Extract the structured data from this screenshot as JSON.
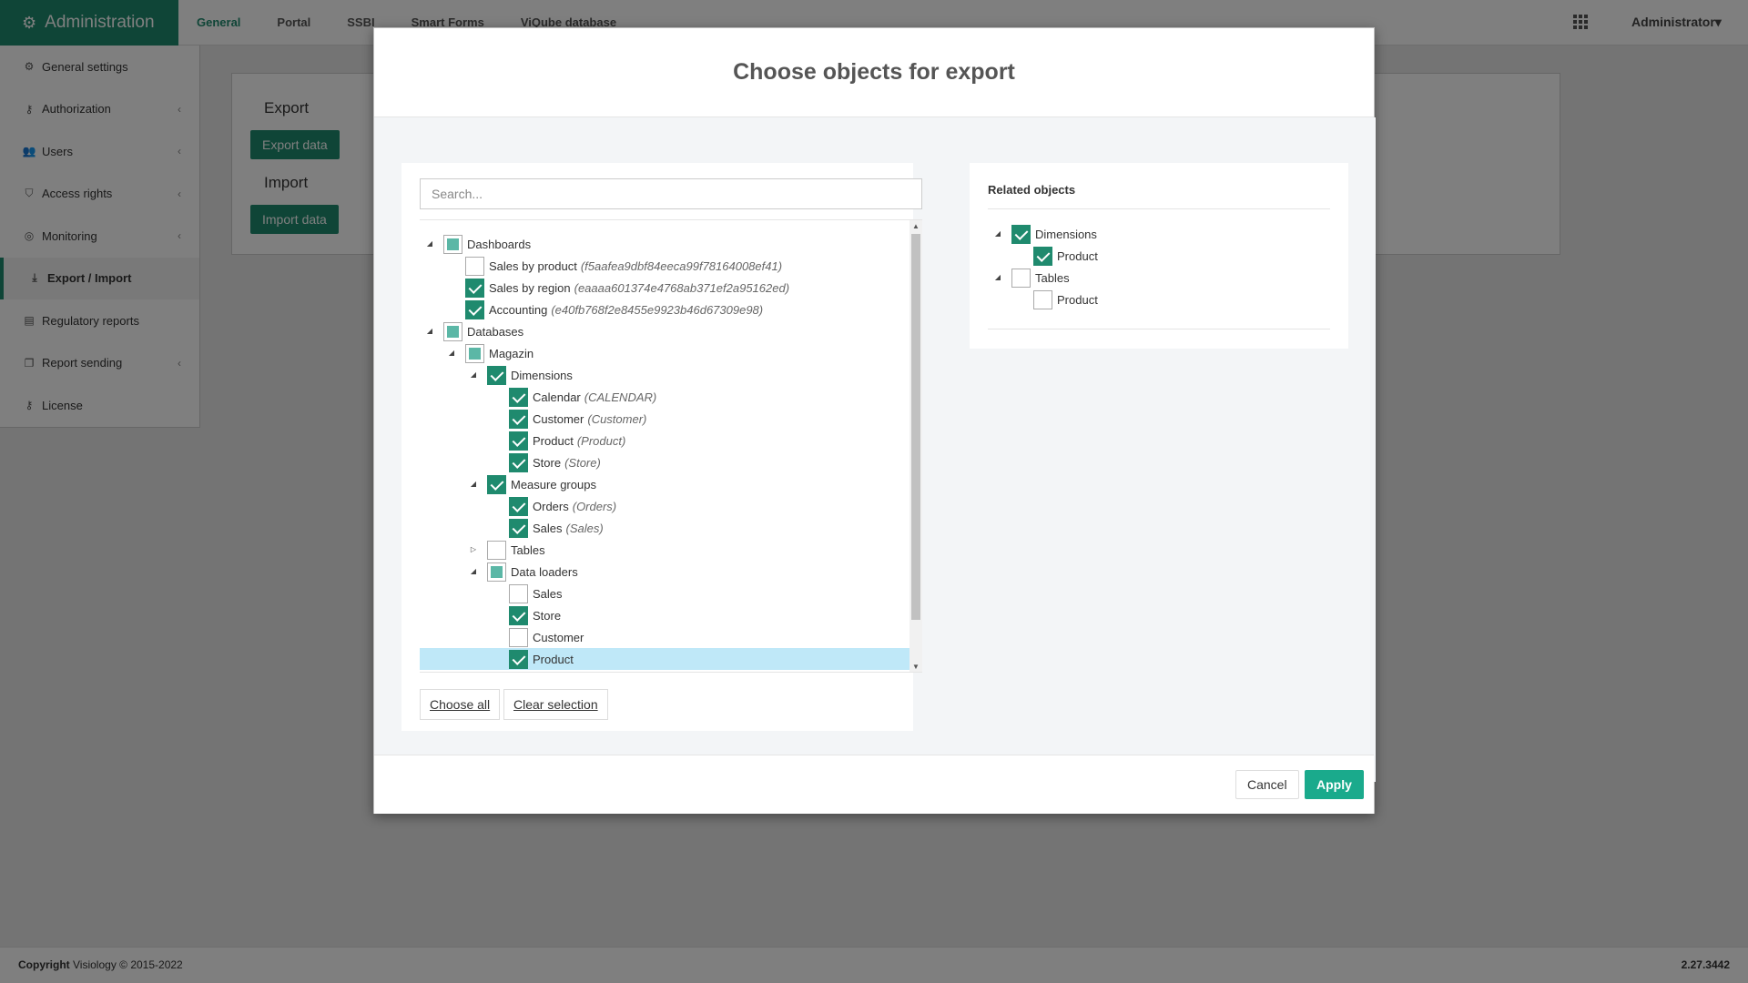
{
  "app": {
    "title": "Administration",
    "icon": "gears-icon"
  },
  "top_nav": [
    "General",
    "Portal",
    "SSBI",
    "Smart Forms",
    "ViQube database"
  ],
  "top_nav_active": "General",
  "user_menu": "Administrator",
  "sidebar": {
    "items": [
      {
        "label": "General settings",
        "icon": "gear-icon",
        "has_submenu": false
      },
      {
        "label": "Authorization",
        "icon": "key-icon",
        "has_submenu": true
      },
      {
        "label": "Users",
        "icon": "users-icon",
        "has_submenu": true
      },
      {
        "label": "Access rights",
        "icon": "shield-icon",
        "has_submenu": true
      },
      {
        "label": "Monitoring",
        "icon": "monitoring-icon",
        "has_submenu": true
      },
      {
        "label": "Export / Import",
        "icon": "download-icon",
        "has_submenu": false,
        "active": true
      },
      {
        "label": "Regulatory reports",
        "icon": "document-icon",
        "has_submenu": false
      },
      {
        "label": "Report sending",
        "icon": "copy-icon",
        "has_submenu": true
      },
      {
        "label": "License",
        "icon": "key-icon",
        "has_submenu": false
      }
    ]
  },
  "background": {
    "export_heading": "Export",
    "export_button": "Export data",
    "import_heading": "Import",
    "import_button": "Import data"
  },
  "footer": {
    "copyright_bold": "Copyright",
    "copyright_text": "Visiology © 2015-2022",
    "version": "2.27.3442"
  },
  "modal": {
    "title": "Choose objects for export",
    "search_placeholder": "Search...",
    "choose_all": "Choose all",
    "clear_selection": "Clear selection",
    "cancel": "Cancel",
    "apply": "Apply",
    "related_title": "Related objects",
    "tree": [
      {
        "depth": 0,
        "toggle": "expanded",
        "state": "partial",
        "label": "Dashboards",
        "code": ""
      },
      {
        "depth": 1,
        "toggle": "none",
        "state": "unchecked",
        "label": "Sales by product",
        "code": "(f5aafea9dbf84eeca99f78164008ef41)"
      },
      {
        "depth": 1,
        "toggle": "none",
        "state": "checked",
        "label": "Sales by region",
        "code": "(eaaaa601374e4768ab371ef2a95162ed)"
      },
      {
        "depth": 1,
        "toggle": "none",
        "state": "checked",
        "label": "Accounting",
        "code": "(e40fb768f2e8455e9923b46d67309e98)"
      },
      {
        "depth": 0,
        "toggle": "expanded",
        "state": "partial",
        "label": "Databases",
        "code": ""
      },
      {
        "depth": 1,
        "toggle": "expanded",
        "state": "partial",
        "label": "Magazin",
        "code": ""
      },
      {
        "depth": 2,
        "toggle": "expanded",
        "state": "checked",
        "label": "Dimensions",
        "code": ""
      },
      {
        "depth": 3,
        "toggle": "none",
        "state": "checked",
        "label": "Calendar",
        "code": "(CALENDAR)"
      },
      {
        "depth": 3,
        "toggle": "none",
        "state": "checked",
        "label": "Customer",
        "code": "(Customer)"
      },
      {
        "depth": 3,
        "toggle": "none",
        "state": "checked",
        "label": "Product",
        "code": "(Product)"
      },
      {
        "depth": 3,
        "toggle": "none",
        "state": "checked",
        "label": "Store",
        "code": "(Store)"
      },
      {
        "depth": 2,
        "toggle": "expanded",
        "state": "checked",
        "label": "Measure groups",
        "code": ""
      },
      {
        "depth": 3,
        "toggle": "none",
        "state": "checked",
        "label": "Orders",
        "code": "(Orders)"
      },
      {
        "depth": 3,
        "toggle": "none",
        "state": "checked",
        "label": "Sales",
        "code": "(Sales)"
      },
      {
        "depth": 2,
        "toggle": "collapsed",
        "state": "unchecked",
        "label": "Tables",
        "code": ""
      },
      {
        "depth": 2,
        "toggle": "expanded",
        "state": "partial",
        "label": "Data loaders",
        "code": ""
      },
      {
        "depth": 3,
        "toggle": "none",
        "state": "unchecked",
        "label": "Sales",
        "code": ""
      },
      {
        "depth": 3,
        "toggle": "none",
        "state": "checked",
        "label": "Store",
        "code": ""
      },
      {
        "depth": 3,
        "toggle": "none",
        "state": "unchecked",
        "label": "Customer",
        "code": ""
      },
      {
        "depth": 3,
        "toggle": "none",
        "state": "checked",
        "label": "Product",
        "code": "",
        "selected": true
      }
    ],
    "related": [
      {
        "depth": 0,
        "toggle": "expanded",
        "state": "checked",
        "label": "Dimensions"
      },
      {
        "depth": 1,
        "toggle": "none",
        "state": "checked",
        "label": "Product"
      },
      {
        "depth": 0,
        "toggle": "expanded",
        "state": "unchecked",
        "label": "Tables"
      },
      {
        "depth": 1,
        "toggle": "none",
        "state": "unchecked",
        "label": "Product"
      }
    ]
  },
  "colors": {
    "brand": "#1f8a6e",
    "accent": "#1aaa8c",
    "selection": "#bfe8f8"
  }
}
